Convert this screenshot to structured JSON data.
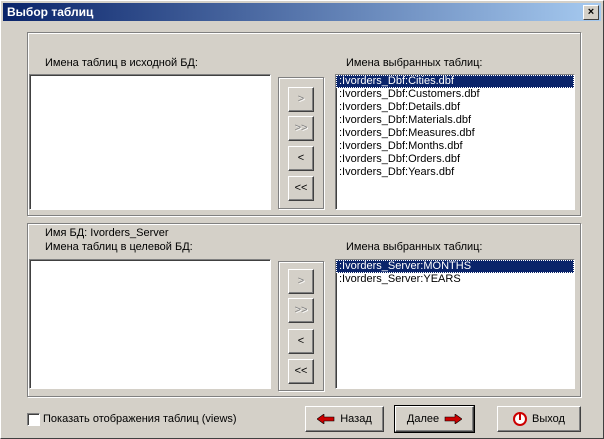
{
  "window": {
    "title": "Выбор таблиц",
    "close_glyph": "×"
  },
  "source": {
    "left_label": "Имена таблиц в исходной БД:",
    "right_label": "Имена выбранных таблиц:",
    "left_items": [],
    "right_items": [
      ":Ivorders_Dbf:Cities.dbf",
      ":Ivorders_Dbf:Customers.dbf",
      ":Ivorders_Dbf:Details.dbf",
      ":Ivorders_Dbf:Materials.dbf",
      ":Ivorders_Dbf:Measures.dbf",
      ":Ivorders_Dbf:Months.dbf",
      ":Ivorders_Dbf:Orders.dbf",
      ":Ivorders_Dbf:Years.dbf"
    ],
    "selected_index": 0,
    "buttons": [
      ">",
      ">>",
      "<",
      "<<"
    ]
  },
  "target": {
    "db_label": "Имя БД: Ivorders_Server",
    "left_label": "Имена таблиц в целевой БД:",
    "right_label": "Имена выбранных таблиц:",
    "left_items": [],
    "right_items": [
      ":Ivorders_Server:MONTHS",
      ":Ivorders_Server:YEARS"
    ],
    "selected_index": 0,
    "buttons": [
      ">",
      ">>",
      "<",
      "<<"
    ]
  },
  "footer": {
    "checkbox_label": "Показать отображения таблиц (views)",
    "checkbox_checked": false,
    "back_label": "Назад",
    "next_label": "Далее",
    "exit_label": "Выход"
  },
  "colors": {
    "selection": "#0a246a",
    "face": "#d4d0c8",
    "arrow_red": "#cc0000"
  }
}
